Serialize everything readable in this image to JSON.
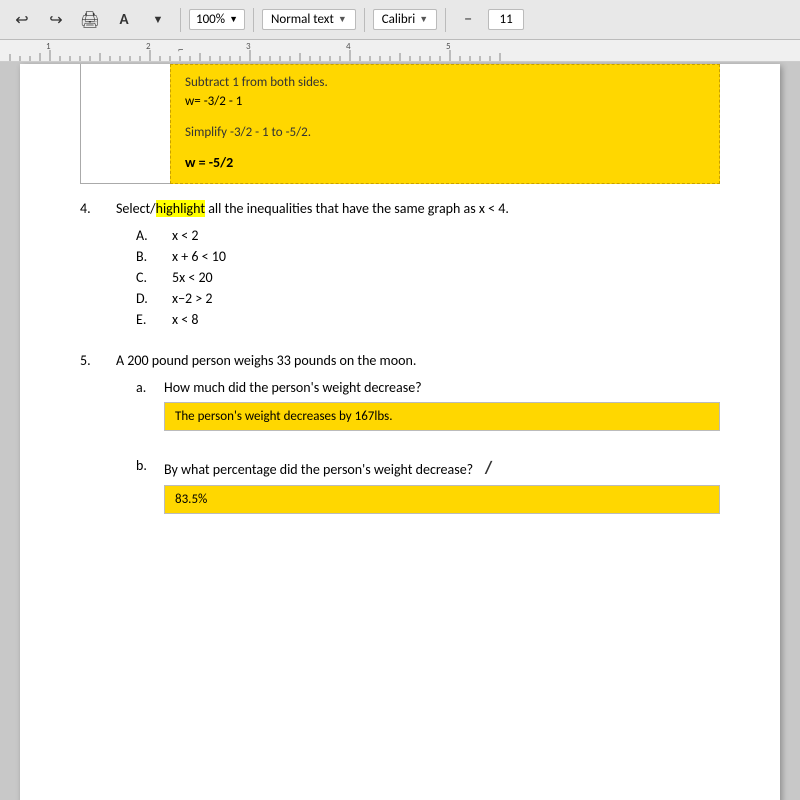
{
  "toolbar": {
    "undo_icon": "↩",
    "redo_icon": "↪",
    "print_icon": "🖨",
    "font_icon": "A",
    "pointer_icon": "▼",
    "zoom_value": "100%",
    "zoom_arrow": "▼",
    "style_label": "Normal text",
    "style_arrow": "▼",
    "font_label": "Calibri",
    "font_arrow": "▼",
    "font_size_minus": "−",
    "font_size_value": "11"
  },
  "ruler": {
    "marks": [
      "1",
      "2",
      "3",
      "4",
      "5"
    ]
  },
  "document": {
    "yellow_top_box": {
      "line1": "Subtract 1 from both sides.",
      "line2": "w= -3/2 - 1",
      "line3": "Simplify -3/2 - 1 to -5/2.",
      "line4": "w = -5/2"
    },
    "q4": {
      "number": "4.",
      "text_before_highlight": "Select/",
      "highlight_word": "highlight",
      "text_after_highlight": " all the inequalities that have the same graph as ",
      "math_expr": "x < 4",
      "period": ".",
      "choices": [
        {
          "letter": "A.",
          "expr": "x < 2"
        },
        {
          "letter": "B.",
          "expr": "x + 6 < 10"
        },
        {
          "letter": "C.",
          "expr": "5x < 20"
        },
        {
          "letter": "D.",
          "expr": "x−2 > 2"
        },
        {
          "letter": "E.",
          "expr": "x < 8"
        }
      ]
    },
    "q5": {
      "number": "5.",
      "text": "A 200 pound person weighs 33 pounds on the moon.",
      "sub_a": {
        "letter": "a.",
        "text": "How much did the person's weight decrease?",
        "answer": "The person's weight decreases by 167lbs."
      },
      "sub_b": {
        "letter": "b.",
        "text": "By what percentage did the person's weight decrease?",
        "answer_partial": "83.5%"
      }
    }
  }
}
